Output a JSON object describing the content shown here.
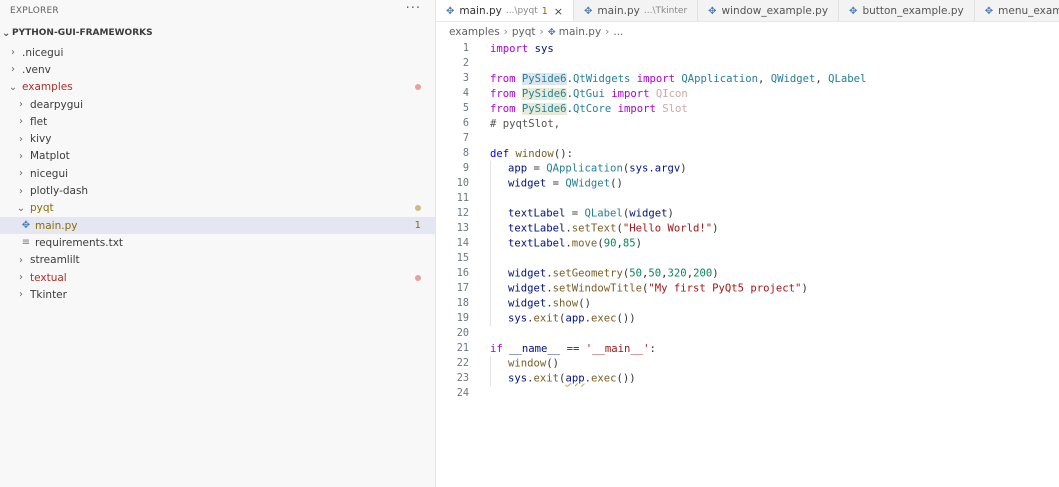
{
  "explorer": {
    "title": "EXPLORER",
    "more": "···",
    "root": "PYTHON-GUI-FRAMEWORKS",
    "items": [
      {
        "label": ".nicegui",
        "indent": 1,
        "chev": "›",
        "status": ""
      },
      {
        "label": ".venv",
        "indent": 1,
        "chev": "›",
        "status": ""
      },
      {
        "label": "examples",
        "indent": 1,
        "chev": "⌄",
        "status": "red"
      },
      {
        "label": "dearpygui",
        "indent": 2,
        "chev": "›",
        "status": ""
      },
      {
        "label": "flet",
        "indent": 2,
        "chev": "›",
        "status": ""
      },
      {
        "label": "kivy",
        "indent": 2,
        "chev": "›",
        "status": ""
      },
      {
        "label": "Matplot",
        "indent": 2,
        "chev": "›",
        "status": ""
      },
      {
        "label": "nicegui",
        "indent": 2,
        "chev": "›",
        "status": ""
      },
      {
        "label": "plotly-dash",
        "indent": 2,
        "chev": "›",
        "status": ""
      },
      {
        "label": "pyqt",
        "indent": 2,
        "chev": "⌄",
        "status": "yellow"
      },
      {
        "label": "main.py",
        "indent": 3,
        "chev": "",
        "icon": "python",
        "status": "count",
        "count": "1",
        "selected": true
      },
      {
        "label": "requirements.txt",
        "indent": 3,
        "chev": "",
        "icon": "text",
        "status": ""
      },
      {
        "label": "streamlilt",
        "indent": 2,
        "chev": "›",
        "status": ""
      },
      {
        "label": "textual",
        "indent": 2,
        "chev": "›",
        "status": "red"
      },
      {
        "label": "Tkinter",
        "indent": 2,
        "chev": "›",
        "status": ""
      }
    ]
  },
  "tabs": [
    {
      "label": "main.py",
      "desc": "...\\pyqt",
      "count": "1",
      "active": true,
      "close": "×"
    },
    {
      "label": "main.py",
      "desc": "...\\Tkinter",
      "active": false
    },
    {
      "label": "window_example.py",
      "desc": "",
      "active": false
    },
    {
      "label": "button_example.py",
      "desc": "",
      "active": false
    },
    {
      "label": "menu_example.py",
      "desc": "",
      "active": false
    }
  ],
  "breadcrumbs": [
    "examples",
    "pyqt",
    "main.py",
    "..."
  ],
  "code": {
    "line_numbers": [
      "1",
      "2",
      "3",
      "4",
      "5",
      "6",
      "7",
      "8",
      "9",
      "10",
      "11",
      "12",
      "13",
      "14",
      "15",
      "16",
      "17",
      "18",
      "19",
      "20",
      "21",
      "22",
      "23",
      "24"
    ]
  },
  "colors": {
    "accent": "#0060c0",
    "selection": "#e4e6f1",
    "modified_red": "#ad2f27",
    "modified_yellow": "#8a6d00"
  }
}
